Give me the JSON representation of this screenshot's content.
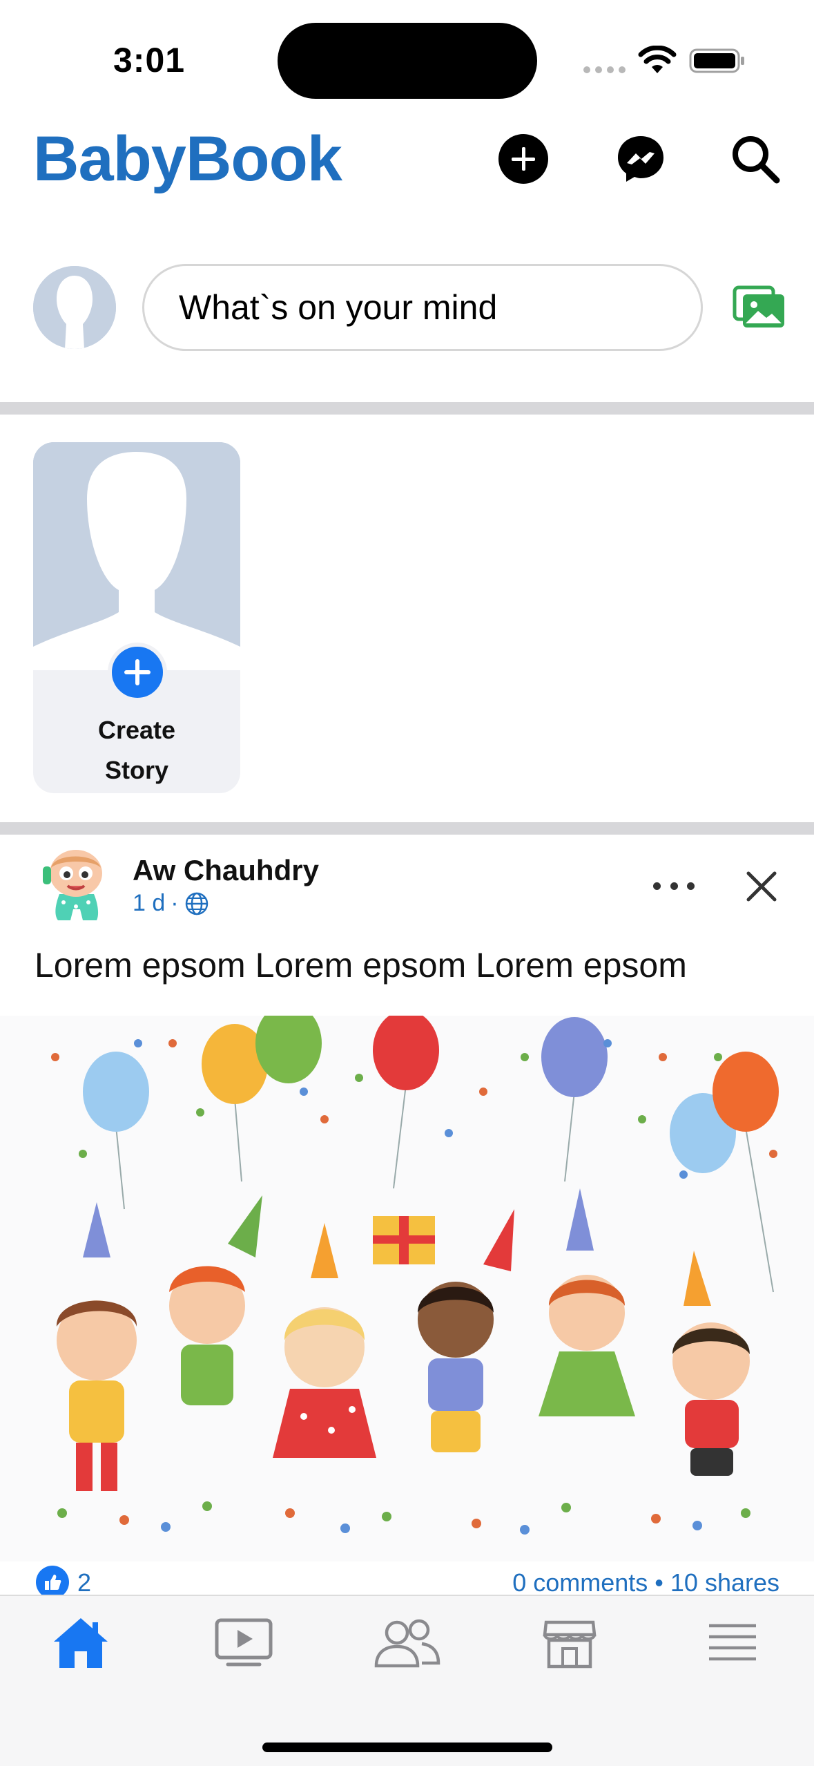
{
  "status_bar": {
    "time": "3:01"
  },
  "header": {
    "brand": "BabyBook",
    "brand_color": "#1f6fbf",
    "actions": [
      "plus-icon",
      "messenger-icon",
      "search-icon"
    ]
  },
  "composer": {
    "placeholder": "What`s on your mind",
    "photo_icon": "photo-icon"
  },
  "stories": {
    "create_story_line1": "Create",
    "create_story_line2": "Story"
  },
  "post": {
    "author": "Aw Chauhdry",
    "time": "1 d",
    "separator": "·",
    "visibility_icon": "globe-icon",
    "text": "Lorem epsom Lorem epsom Lorem epsom",
    "likes": "2",
    "engagement": "0 comments • 10 shares"
  },
  "tab_bar": {
    "tabs": [
      "home-icon",
      "video-icon",
      "friends-icon",
      "marketplace-icon",
      "menu-icon"
    ],
    "active_color": "#1877f2",
    "inactive_color": "#8a8a8e"
  }
}
